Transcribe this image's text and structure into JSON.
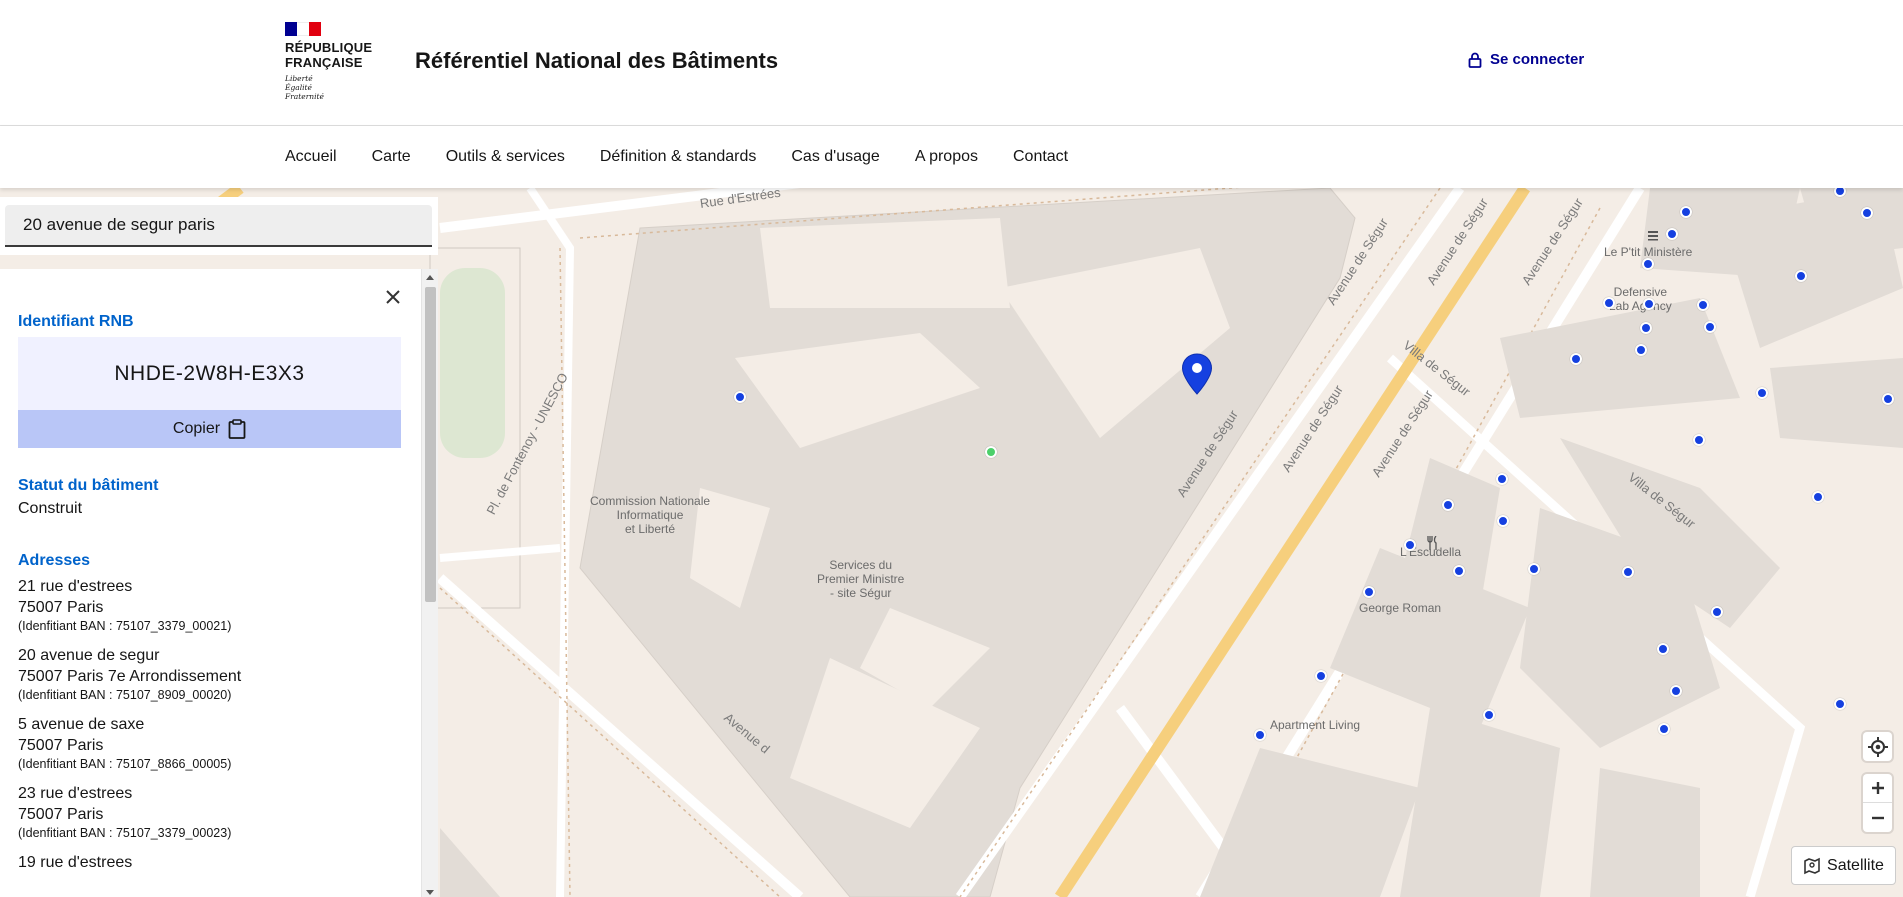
{
  "header": {
    "brand_line1": "RÉPUBLIQUE",
    "brand_line2": "FRANÇAISE",
    "devise": [
      "Liberté",
      "Égalité",
      "Fraternité"
    ],
    "site_title": "Référentiel National des Bâtiments",
    "login_label": "Se connecter"
  },
  "nav": {
    "items": [
      "Accueil",
      "Carte",
      "Outils & services",
      "Définition & standards",
      "Cas d'usage",
      "A propos",
      "Contact"
    ]
  },
  "search": {
    "value": "20 avenue de segur paris"
  },
  "panel": {
    "id_title": "Identifiant RNB",
    "id_value": "NHDE-2W8H-E3X3",
    "copy_label": "Copier",
    "status_title": "Statut du bâtiment",
    "status_value": "Construit",
    "addresses_title": "Adresses",
    "addresses": [
      {
        "l1": "21 rue d'estrees",
        "l2": "75007 Paris",
        "ban": "(Idenfitiant BAN : 75107_3379_00021)"
      },
      {
        "l1": "20 avenue de segur",
        "l2": "75007 Paris 7e Arrondissement",
        "ban": "(Idenfitiant BAN : 75107_8909_00020)"
      },
      {
        "l1": "5 avenue de saxe",
        "l2": "75007 Paris",
        "ban": "(Idenfitiant BAN : 75107_8866_00005)"
      },
      {
        "l1": "23 rue d'estrees",
        "l2": "75007 Paris",
        "ban": "(Idenfitiant BAN : 75107_3379_00023)"
      },
      {
        "l1": "19 rue d'estrees",
        "l2": "",
        "ban": ""
      }
    ]
  },
  "map": {
    "labels": {
      "cnil": "Commission Nationale\nInformatique\net Liberté",
      "spm": "Services du\nPremier Ministre\n- site Ségur",
      "ptit": "Le P'tit Ministère",
      "defensive": "Defensive\nLab Agency",
      "escudella": "L'Escudella",
      "george": "George Roman",
      "apartment": "Apartment Living"
    },
    "streets": {
      "rue_estrees": "Rue d'Estrées",
      "segur": "Avenue de Ségur",
      "villa_segur": "Villa de Ségur",
      "fontenoy": "Pl. de Fontenoy - UNESCO",
      "avenue_d": "Avenue d"
    },
    "satellite_label": "Satellite",
    "colors": {
      "marker": "#1540e0",
      "building": "#e2dcd6",
      "major_road": "#f6cf7d"
    }
  }
}
